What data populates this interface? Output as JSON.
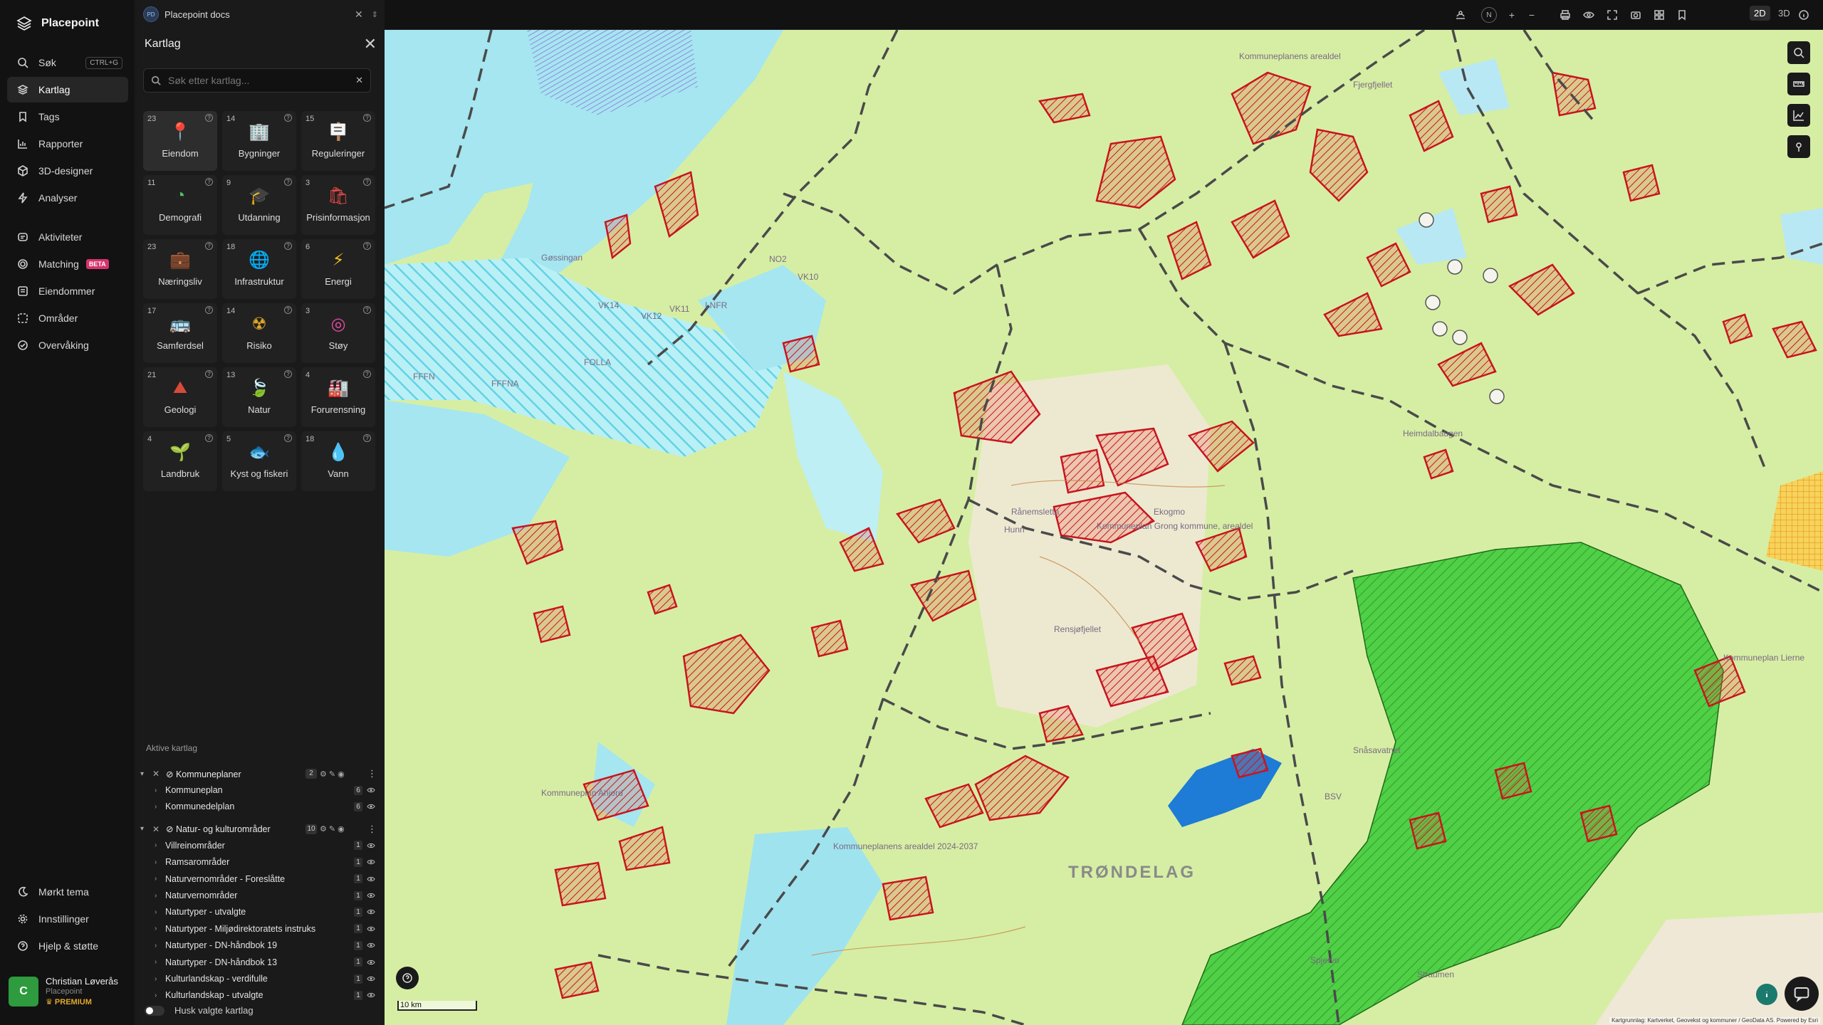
{
  "app": {
    "name": "Placepoint"
  },
  "nav": {
    "items": [
      {
        "label": "Søk",
        "shortcut": "CTRL+G"
      },
      {
        "label": "Kartlag"
      },
      {
        "label": "Tags"
      },
      {
        "label": "Rapporter"
      },
      {
        "label": "3D-designer"
      },
      {
        "label": "Analyser"
      },
      {
        "label": "Aktiviteter"
      },
      {
        "label": "Matching",
        "badge": "BETA"
      },
      {
        "label": "Eiendommer"
      },
      {
        "label": "Områder"
      },
      {
        "label": "Overvåking"
      }
    ],
    "bottom": [
      {
        "label": "Mørkt tema"
      },
      {
        "label": "Innstillinger"
      },
      {
        "label": "Hjelp & støtte"
      }
    ],
    "user": {
      "initial": "C",
      "name": "Christian Løverås",
      "org": "Placepoint",
      "plan": "PREMIUM"
    }
  },
  "panel": {
    "tab": {
      "initials": "PD",
      "title": "Placepoint docs"
    },
    "title": "Kartlag",
    "search_placeholder": "Søk etter kartlag...",
    "tiles": [
      {
        "count": "23",
        "label": "Eiendom",
        "icon": "pin-icon",
        "glyph": "📍",
        "color": "#e03a3a"
      },
      {
        "count": "14",
        "label": "Bygninger",
        "icon": "building-icon",
        "glyph": "🏢",
        "color": "#7aa0d8"
      },
      {
        "count": "15",
        "label": "Reguleringer",
        "icon": "signpost-icon",
        "glyph": "🪧",
        "color": "#e6a020"
      },
      {
        "count": "11",
        "label": "Demografi",
        "icon": "demography-icon",
        "glyph": "◔",
        "color": "#4ec06a"
      },
      {
        "count": "9",
        "label": "Utdanning",
        "icon": "graduation-cap-icon",
        "glyph": "🎓",
        "color": "#4a7fd6"
      },
      {
        "count": "3",
        "label": "Prisinformasjon",
        "icon": "shopping-bag-icon",
        "glyph": "🛍",
        "color": "#e84848"
      },
      {
        "count": "23",
        "label": "Næringsliv",
        "icon": "briefcase-icon",
        "glyph": "💼",
        "color": "#e84848"
      },
      {
        "count": "18",
        "label": "Infrastruktur",
        "icon": "globe-icon",
        "glyph": "🌐",
        "color": "#8a6ce0"
      },
      {
        "count": "6",
        "label": "Energi",
        "icon": "lightning-icon",
        "glyph": "⚡",
        "color": "#f0c020"
      },
      {
        "count": "17",
        "label": "Samferdsel",
        "icon": "bus-icon",
        "glyph": "🚌",
        "color": "#e0d8c0"
      },
      {
        "count": "14",
        "label": "Risiko",
        "icon": "hazard-icon",
        "glyph": "☢",
        "color": "#e0a828"
      },
      {
        "count": "3",
        "label": "Støy",
        "icon": "noise-icon",
        "glyph": "◎",
        "color": "#e84aa0"
      },
      {
        "count": "21",
        "label": "Geologi",
        "icon": "geology-icon",
        "glyph": "⛰",
        "color": "#d84a3a"
      },
      {
        "count": "13",
        "label": "Natur",
        "icon": "leaf-icon",
        "glyph": "🍃",
        "color": "#3cc05a"
      },
      {
        "count": "4",
        "label": "Forurensning",
        "icon": "factory-icon",
        "glyph": "🏭",
        "color": "#8ab0e0"
      },
      {
        "count": "4",
        "label": "Landbruk",
        "icon": "sprout-icon",
        "glyph": "🌱",
        "color": "#3cc05a"
      },
      {
        "count": "5",
        "label": "Kyst og fiskeri",
        "icon": "fish-icon",
        "glyph": "🐟",
        "color": "#f0a030"
      },
      {
        "count": "18",
        "label": "Vann",
        "icon": "water-drop-icon",
        "glyph": "💧",
        "color": "#5ab0f0"
      }
    ],
    "active_title": "Aktive kartlag",
    "groups": [
      {
        "title": "Kommuneplaner",
        "count": "2",
        "rows": [
          {
            "label": "Kommuneplan",
            "count": "6"
          },
          {
            "label": "Kommunedelplan",
            "count": "6"
          }
        ]
      },
      {
        "title": "Natur- og kulturområder",
        "count": "10",
        "rows": [
          {
            "label": "Villreinområder",
            "count": "1"
          },
          {
            "label": "Ramsarområder",
            "count": "1"
          },
          {
            "label": "Naturvernområder - Foreslåtte",
            "count": "1"
          },
          {
            "label": "Naturvernområder",
            "count": "1"
          },
          {
            "label": "Naturtyper - utvalgte",
            "count": "1"
          },
          {
            "label": "Naturtyper - Miljødirektoratets instruks",
            "count": "1"
          },
          {
            "label": "Naturtyper - DN-håndbok 19",
            "count": "1"
          },
          {
            "label": "Naturtyper - DN-håndbok 13",
            "count": "1"
          },
          {
            "label": "Kulturlandskap - verdifulle",
            "count": "1"
          },
          {
            "label": "Kulturlandskap - utvalgte",
            "count": "1"
          }
        ]
      }
    ],
    "remember_label": "Husk valgte kartlag"
  },
  "toolbar": {
    "mode_2d": "2D",
    "mode_3d": "3D",
    "north": "N"
  },
  "map": {
    "scale_label": "10 km",
    "attribution": "Kartgrunnlag: Kartverket, Geovekst og kommuner / GeoData AS. Powered by Esri",
    "labels": [
      "Kommuneplanens arealdel",
      "Kommuneplan Grong kommune, arealdel",
      "Kommuneplan Lierne",
      "Kommuneplan Ahjord",
      "TRØNDELAG",
      "Rånemsletta",
      "Ekogmo",
      "Hunn",
      "Rensjøfjellet",
      "Fjergfjellet",
      "NO2",
      "LNFR",
      "FFFNA",
      "FFFN",
      "BSV",
      "VK14",
      "VK12",
      "VK11",
      "VK10",
      "Gøssingan",
      "FOLLA",
      "Kommuneplanens arealdel 2024-2037",
      "Heimdalbaugen",
      "Snåsavatnet",
      "Straumen",
      "Spjervo"
    ]
  },
  "colors": {
    "accent_nav": "#262626",
    "map_land": "#d6eea4",
    "map_water": "#9fe3ef",
    "map_zone": "#c8141e",
    "map_nature": "#3ec43a",
    "beta": "#d6336c",
    "premium": "#e0a82e"
  }
}
